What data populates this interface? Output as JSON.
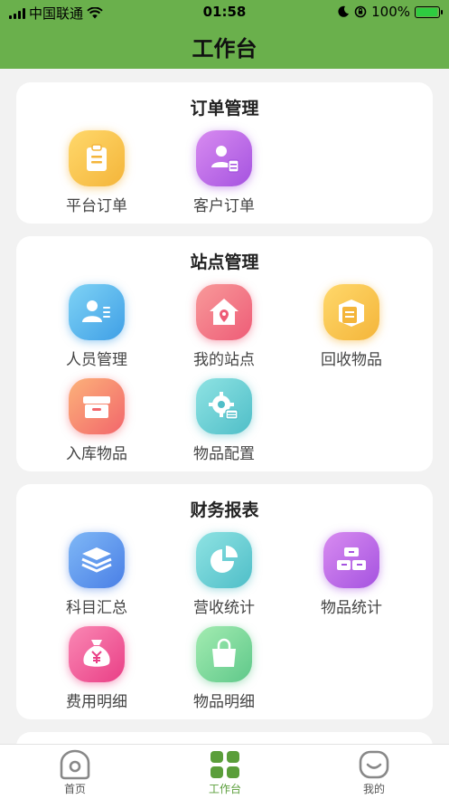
{
  "status_bar": {
    "carrier": "中国联通",
    "time": "01:58",
    "battery": "100%",
    "battery_level": 1.0
  },
  "header": {
    "title": "工作台"
  },
  "sections": [
    {
      "title": "订单管理",
      "items": [
        {
          "label": "平台订单",
          "icon": "clipboard-icon",
          "color": "#f4b53a"
        },
        {
          "label": "客户订单",
          "icon": "customer-document-icon",
          "color": "#a553e0"
        }
      ]
    },
    {
      "title": "站点管理",
      "items": [
        {
          "label": "人员管理",
          "icon": "person-card-icon",
          "color": "#3f9fe6"
        },
        {
          "label": "我的站点",
          "icon": "house-pin-icon",
          "color": "#ee5c77"
        },
        {
          "label": "回收物品",
          "icon": "recycle-box-icon",
          "color": "#f4b53a"
        },
        {
          "label": "入库物品",
          "icon": "storage-box-icon",
          "color": "#f2666b"
        },
        {
          "label": "物品配置",
          "icon": "gear-config-icon",
          "color": "#4fbec8"
        }
      ]
    },
    {
      "title": "财务报表",
      "items": [
        {
          "label": "科目汇总",
          "icon": "layers-icon",
          "color": "#4a7fe6"
        },
        {
          "label": "营收统计",
          "icon": "pie-chart-icon",
          "color": "#4fbec8"
        },
        {
          "label": "物品统计",
          "icon": "blocks-icon",
          "color": "#a553e0"
        },
        {
          "label": "费用明细",
          "icon": "money-bag-icon",
          "color": "#e93f86"
        },
        {
          "label": "物品明细",
          "icon": "shopping-bag-icon",
          "color": "#5fc88a"
        }
      ]
    }
  ],
  "tabs": [
    {
      "label": "首页",
      "icon": "home-icon",
      "active": false
    },
    {
      "label": "工作台",
      "icon": "workbench-grid-icon",
      "active": true
    },
    {
      "label": "我的",
      "icon": "smile-face-icon",
      "active": false
    }
  ],
  "colors": {
    "header_bg": "#6ab04c",
    "active_tab": "#5a9e3a"
  }
}
